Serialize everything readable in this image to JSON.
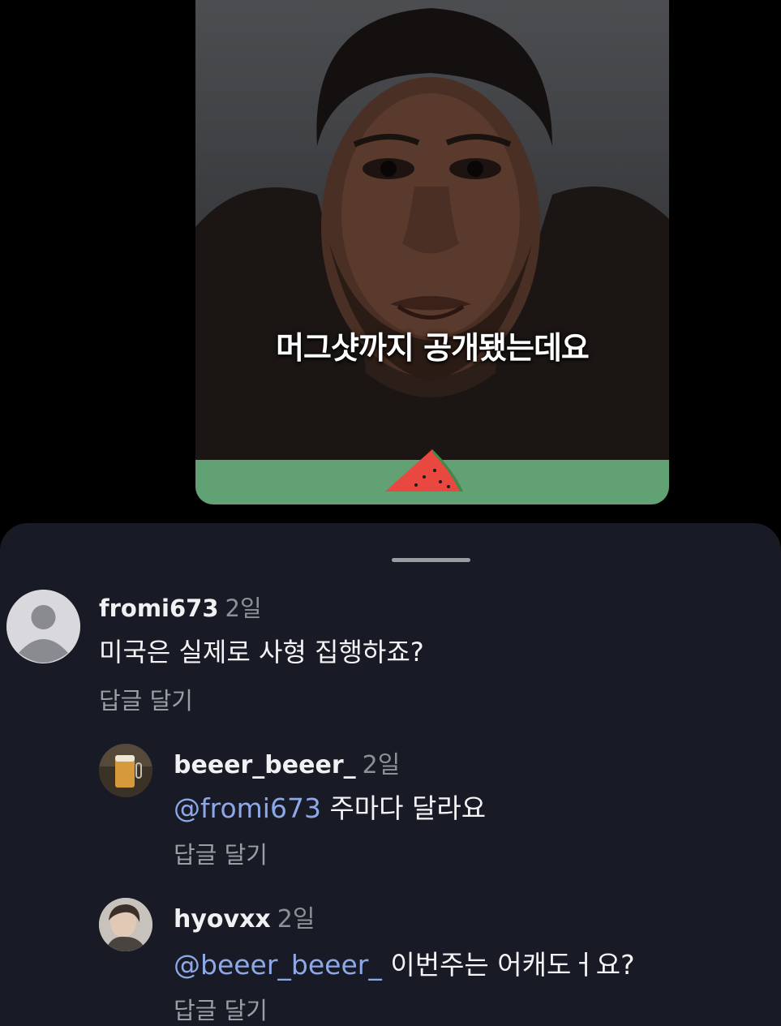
{
  "video": {
    "caption": "머그샷까지 공개됐는데요"
  },
  "comments": [
    {
      "username": "fromi673",
      "time": "2일",
      "text": "미국은 실제로 사형 집행하죠?",
      "reply_label": "답글 달기",
      "avatar": "default-person-icon"
    },
    {
      "username": "beeer_beeer_",
      "time": "2일",
      "mention": "@fromi673",
      "text": " 주마다 달라요",
      "reply_label": "답글 달기",
      "avatar": "beer-glass-photo"
    },
    {
      "username": "hyovxx",
      "time": "2일",
      "mention": "@beeer_beeer_",
      "text": " 이번주는 어캐도ㅓ요?",
      "reply_label": "답글 달기",
      "avatar": "person-photo"
    }
  ],
  "colors": {
    "sheet_bg": "#181b25",
    "mention": "#8ea7e6",
    "green_band": "#62a173"
  }
}
